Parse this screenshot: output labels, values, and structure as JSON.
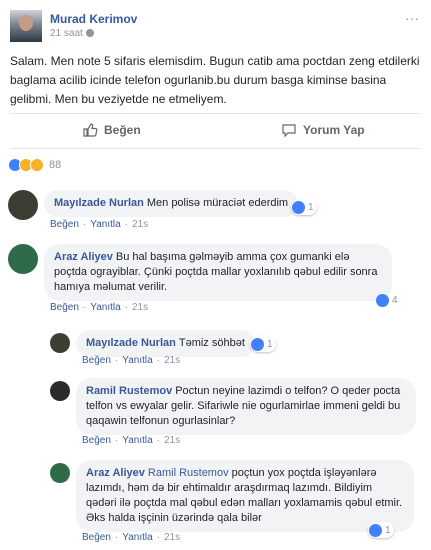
{
  "post": {
    "author": "Murad Kerimov",
    "time": "21 saat",
    "text": "Salam. Men note 5 sifaris elemisdim. Bugun catib ama poctdan zeng etdilerki baglama acilib icinde telefon ogurlanib.bu durum basga kiminse basina gelibmi. Men bu veziyetde ne etmeliyem.",
    "more_label": "···"
  },
  "actions": {
    "like_label": "Beğen",
    "comment_label": "Yorum Yap"
  },
  "reactions": {
    "count": "88",
    "types": [
      "like-icon",
      "wow-icon",
      "sad-icon"
    ]
  },
  "comment_meta": {
    "like": "Beğen",
    "reply": "Yanıtla",
    "dot": "·"
  },
  "comments": [
    {
      "name": "Mayılzade Nurlan",
      "text": "Men polisə müraciət ederdim",
      "time": "21s",
      "reactions": "1"
    },
    {
      "name": "Araz Aliyev",
      "text": "Bu hal başıma gəlməyib amma çox gumanki elə poçtda ograyiblar. Çünki poçtda mallar yoxlanılıb qəbul edilir sonra hamıya məlumat verilir.",
      "time": "21s",
      "reactions": "4"
    }
  ],
  "replies": [
    {
      "name": "Mayılzade Nurlan",
      "text": "Təmiz söhbət",
      "time": "21s",
      "reactions": "1"
    },
    {
      "name": "Ramil Rustemov",
      "text": "Poctun neyine lazimdi o telfon? O qeder pocta telfon vs ewyalar gelir. Sifariwle nie ogurlamirlae immeni geldi bu qaqawin telfonun ogurlasinlar?",
      "time": "21s",
      "reactions": ""
    },
    {
      "name": "Araz Aliyev",
      "tag": "Ramil Rustemov",
      "text": "poçtun yox poçtda işləyənlərə lazımdı, həm də bir ehtimaldır araşdırmaq lazımdı. Bildiyim qədəri ilə poçtda mal qəbul edən malları yoxlamamis qəbul etmir. Əks halda işçinin üzərində qala bilər",
      "time": "21s",
      "reactions": "1"
    }
  ],
  "colors": {
    "link": "#385898",
    "like_blue": "#4080ff",
    "bubble": "#f2f3f5",
    "muted": "#90949c"
  }
}
